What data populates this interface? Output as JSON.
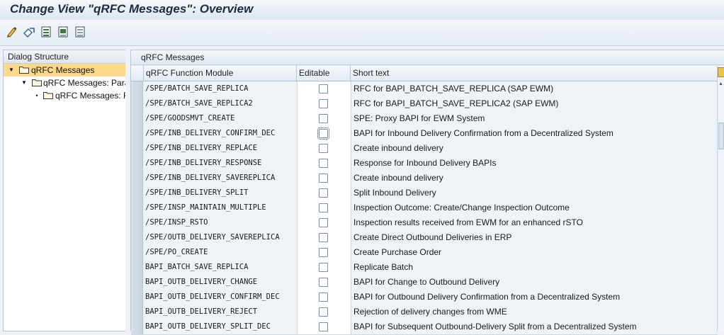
{
  "window": {
    "title": "Change View \"qRFC Messages\": Overview"
  },
  "toolbar": {
    "buttons": [
      {
        "name": "display-change-icon"
      },
      {
        "name": "other-view-icon"
      },
      {
        "name": "select-all-icon"
      },
      {
        "name": "select-block-icon"
      },
      {
        "name": "deselect-all-icon"
      }
    ]
  },
  "tree": {
    "header": "Dialog Structure",
    "items": [
      {
        "label": "qRFC Messages"
      },
      {
        "label": "qRFC Messages: Parar"
      },
      {
        "label": "qRFC Messages: Fi"
      }
    ]
  },
  "table": {
    "title": "qRFC Messages",
    "columns": [
      "qRFC Function Module",
      "Editable",
      "Short text"
    ],
    "rows": [
      {
        "module": "/SPE/BATCH_SAVE_REPLICA",
        "text": "RFC for BAPI_BATCH_SAVE_REPLICA (SAP EWM)"
      },
      {
        "module": "/SPE/BATCH_SAVE_REPLICA2",
        "text": "RFC for BAPI_BATCH_SAVE_REPLICA2 (SAP EWM)"
      },
      {
        "module": "/SPE/GOODSMVT_CREATE",
        "text": "SPE: Proxy BAPI for EWM System"
      },
      {
        "module": "/SPE/INB_DELIVERY_CONFIRM_DEC",
        "text": "BAPI for Inbound Delivery Confirmation from a Decentralized System"
      },
      {
        "module": "/SPE/INB_DELIVERY_REPLACE",
        "text": "Create inbound delivery"
      },
      {
        "module": "/SPE/INB_DELIVERY_RESPONSE",
        "text": "Response for Inbound Delivery BAPIs"
      },
      {
        "module": "/SPE/INB_DELIVERY_SAVEREPLICA",
        "text": "Create inbound delivery"
      },
      {
        "module": "/SPE/INB_DELIVERY_SPLIT",
        "text": "Split Inbound Delivery"
      },
      {
        "module": "/SPE/INSP_MAINTAIN_MULTIPLE",
        "text": "Inspection Outcome: Create/Change Inspection Outcome"
      },
      {
        "module": "/SPE/INSP_RSTO",
        "text": "Inspection results received from EWM for an enhanced rSTO"
      },
      {
        "module": "/SPE/OUTB_DELIVERY_SAVEREPLICA",
        "text": "Create Direct Outbound Deliveries in ERP"
      },
      {
        "module": "/SPE/PO_CREATE",
        "text": "Create Purchase Order"
      },
      {
        "module": "BAPI_BATCH_SAVE_REPLICA",
        "text": "Replicate Batch"
      },
      {
        "module": "BAPI_OUTB_DELIVERY_CHANGE",
        "text": "BAPI for Change to Outbound Delivery"
      },
      {
        "module": "BAPI_OUTB_DELIVERY_CONFIRM_DEC",
        "text": "BAPI for Outbound Delivery Confirmation from a Decentralized System"
      },
      {
        "module": "BAPI_OUTB_DELIVERY_REJECT",
        "text": "Rejection of delivery changes from WME"
      },
      {
        "module": "BAPI_OUTB_DELIVERY_SPLIT_DEC",
        "text": "BAPI for Subsequent Outbound-Delivery Split from a Decentralized System"
      }
    ]
  }
}
